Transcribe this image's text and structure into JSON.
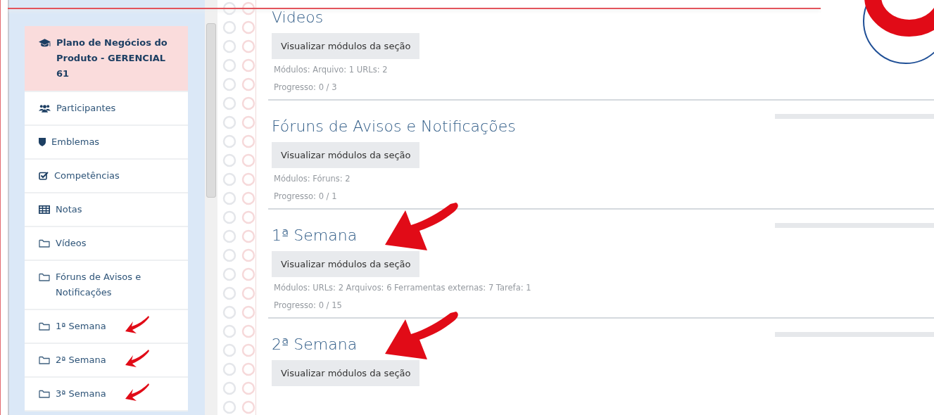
{
  "sidebar": {
    "items": [
      {
        "kind": "course",
        "label": "Plano de Negócios do Produto - GERENCIAL 61",
        "selected": true,
        "marked": false
      },
      {
        "kind": "participants",
        "label": "Participantes",
        "selected": false,
        "marked": false
      },
      {
        "kind": "badges",
        "label": "Emblemas",
        "selected": false,
        "marked": false
      },
      {
        "kind": "competencies",
        "label": "Competências",
        "selected": false,
        "marked": false
      },
      {
        "kind": "grades",
        "label": "Notas",
        "selected": false,
        "marked": false
      },
      {
        "kind": "folder",
        "label": "Vídeos",
        "selected": false,
        "marked": false
      },
      {
        "kind": "folder",
        "label": "Fóruns de Avisos e Notificações",
        "selected": false,
        "marked": false
      },
      {
        "kind": "folder",
        "label": "1ª Semana",
        "selected": false,
        "marked": true
      },
      {
        "kind": "folder",
        "label": "2ª Semana",
        "selected": false,
        "marked": true
      },
      {
        "kind": "folder",
        "label": "3ª Semana",
        "selected": false,
        "marked": true
      }
    ]
  },
  "sections": [
    {
      "title": "Videos",
      "button": "Visualizar módulos da seção",
      "modules": "Módulos:  Arquivo: 1  URLs: 2",
      "progress": "Progresso: 0 / 3",
      "marked": false
    },
    {
      "title": "Fóruns de Avisos e Notificações",
      "button": "Visualizar módulos da seção",
      "modules": "Módulos:  Fóruns: 2",
      "progress": "Progresso: 0 / 1",
      "marked": false,
      "level": 0
    },
    {
      "title": "1ª Semana",
      "button": "Visualizar módulos da seção",
      "modules": "Módulos:  URLs: 2  Arquivos: 6  Ferramentas externas: 7  Tarefa: 1",
      "progress": "Progresso: 0 / 15",
      "marked": true,
      "level": 0
    },
    {
      "title": "2ª Semana",
      "button": "Visualizar módulos da seção",
      "marked": true,
      "level": 0
    }
  ]
}
